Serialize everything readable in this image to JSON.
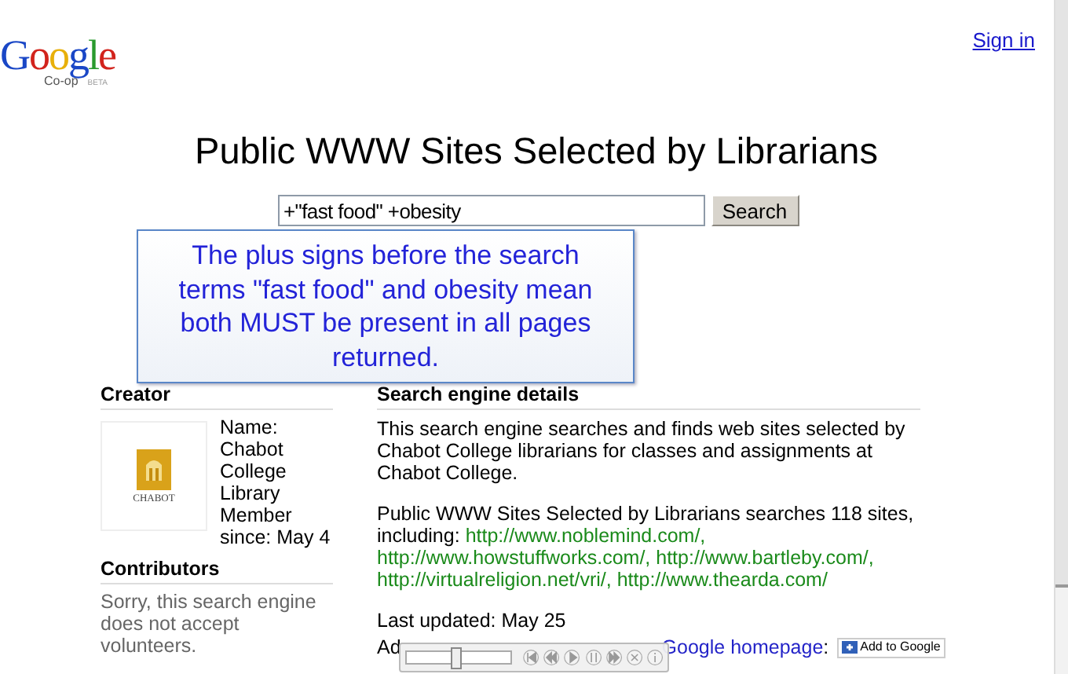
{
  "logo": {
    "word": "Google",
    "sub": "Co-op",
    "badge": "BETA"
  },
  "sign_in": "Sign in",
  "title": "Public WWW Sites Selected by Librarians",
  "search": {
    "value": "+\"fast food\" +obesity",
    "button": "Search"
  },
  "callout": "The plus signs before the search terms \"fast food\" and obesity mean both MUST be present in all pages returned.",
  "creator": {
    "heading": "Creator",
    "logo_text": "CHABOT",
    "info": "Name: Chabot College Library Member since: May 4"
  },
  "contributors": {
    "heading": "Contributors",
    "text": "Sorry, this search engine does not accept volunteers."
  },
  "details": {
    "heading": "Search engine details",
    "description": "This search engine searches and finds web sites selected by Chabot College librarians for classes and assignments at Chabot College.",
    "sites_text": "Public WWW Sites Selected by Librarians searches 118 sites, including:",
    "sites": [
      "http://www.noblemind.com/,",
      "http://www.howstuffworks.com/,",
      "http://www.bartleby.com/,",
      "http://virtualreligion.net/vri/,",
      "http://www.thearda.com/"
    ],
    "updated": "Last updated: May 25",
    "add_start": "Ad",
    "add_link": "Google homepage",
    "add_end": ":",
    "add_button": "Add to Google"
  },
  "player": {
    "level": 0.47
  }
}
